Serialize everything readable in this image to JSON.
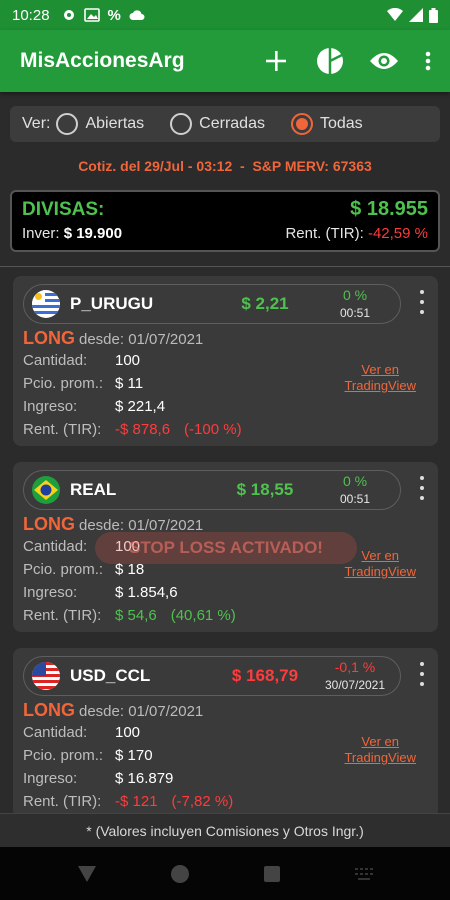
{
  "status": {
    "time": "10:28",
    "percent_icon": "%"
  },
  "app": {
    "title": "MisAccionesArg",
    "actions": [
      "add-icon",
      "pie-chart-icon",
      "eye-icon",
      "more-vert-icon"
    ]
  },
  "filter": {
    "label": "Ver:",
    "options": [
      {
        "label": "Abiertas",
        "selected": false
      },
      {
        "label": "Cerradas",
        "selected": false
      },
      {
        "label": "Todas",
        "selected": true
      }
    ]
  },
  "quote_line": "Cotiz. del 29/Jul - 03:12  -  S&P MERV: 67363",
  "divisas": {
    "title": "DIVISAS:",
    "value": "$ 18.955",
    "inver_label": "Inver:",
    "inver_value": "$ 19.900",
    "rent_label": "Rent. (TIR):",
    "rent_value": "-42,59 %"
  },
  "labels": {
    "long": "LONG",
    "cantidad": "Cantidad:",
    "pcio": "Pcio. prom.:",
    "ingreso": "Ingreso:",
    "rent": "Rent. (TIR):",
    "tv_line1": "Ver en",
    "tv_line2": "TradingView"
  },
  "cards": [
    {
      "flag": "uruguay",
      "ticker": "P_URUGU",
      "price": "$ 2,21",
      "price_color": "green",
      "change": "0 %",
      "time": "00:51",
      "since": "desde: 01/07/2021",
      "cantidad": "100",
      "pcio": "$ 11",
      "ingreso": "$ 221,4",
      "rent": "-$ 878,6",
      "rent_pct": "(-100 %)",
      "rent_color": "red"
    },
    {
      "flag": "brazil",
      "ticker": "REAL",
      "price": "$ 18,55",
      "price_color": "green",
      "change": "0 %",
      "time": "00:51",
      "since": "desde: 01/07/2021",
      "cantidad": "100",
      "pcio": "$ 18",
      "ingreso": "$ 1.854,6",
      "rent": "$ 54,6",
      "rent_pct": "(40,61 %)",
      "rent_color": "green",
      "overlay": "STOP LOSS ACTIVADO!"
    },
    {
      "flag": "usa",
      "ticker": "USD_CCL",
      "price": "$ 168,79",
      "price_color": "red",
      "change": "-0,1 %",
      "time": "30/07/2021",
      "since": "desde: 01/07/2021",
      "cantidad": "100",
      "pcio": "$ 170",
      "ingreso": "$ 16.879",
      "rent": "-$ 121",
      "rent_pct": "(-7,82 %)",
      "rent_color": "red"
    }
  ],
  "footer": "* (Valores incluyen Comisiones y Otros Ingr.)",
  "colors": {
    "green": "#4fc14f",
    "red": "#ff3b3b",
    "accent": "#f0663a",
    "appbar": "#239b3a"
  }
}
